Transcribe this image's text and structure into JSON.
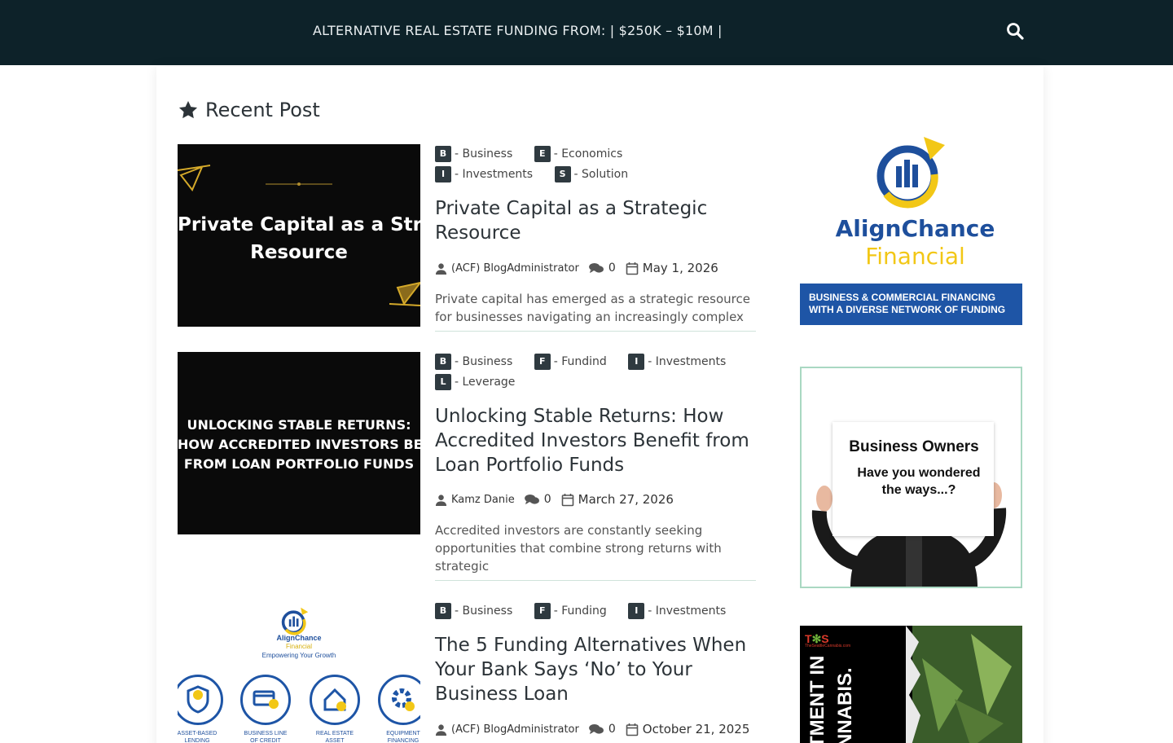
{
  "header": {
    "tagline": "ALTERNATIVE REAL ESTATE FUNDING FROM: | $250K – $10M |",
    "search_icon": "search-icon"
  },
  "section": {
    "title": "Recent Post",
    "icon": "star-icon"
  },
  "posts": [
    {
      "thumb_caption_1": "Private Capital as a Strategic",
      "thumb_caption_2": "Resource",
      "categories": [
        {
          "letter": "B",
          "label": "- Business"
        },
        {
          "letter": "E",
          "label": "- Economics"
        },
        {
          "letter": "I",
          "label": "- Investments"
        },
        {
          "letter": "S",
          "label": "- Solution"
        }
      ],
      "title": "Private Capital as a Strategic Resource",
      "author": "(ACF) BlogAdministrator",
      "comments": "0",
      "date": "May 1, 2026",
      "excerpt": "Private capital has emerged as a strategic resource for businesses navigating an increasingly complex"
    },
    {
      "thumb_caption_1": "UNLOCKING STABLE RETURNS:",
      "thumb_caption_2": "HOW ACCREDITED INVESTORS BENEFIT",
      "thumb_caption_3": "FROM LOAN PORTFOLIO FUNDS",
      "categories": [
        {
          "letter": "B",
          "label": "- Business"
        },
        {
          "letter": "F",
          "label": "- Fundind"
        },
        {
          "letter": "I",
          "label": "- Investments"
        },
        {
          "letter": "L",
          "label": "- Leverage"
        }
      ],
      "title": "Unlocking Stable Returns: How Accredited Investors Benefit from Loan Portfolio Funds",
      "author": "Kamz Danie",
      "comments": "0",
      "date": "March 27, 2026",
      "excerpt": "Accredited investors are constantly seeking opportunities that combine strong returns with strategic"
    },
    {
      "thumb_brand": "AlignChance",
      "thumb_brand_sub": "Financial",
      "thumb_tagline": "Empowering Your Growth",
      "thumb_services": [
        "ASSET-BASED LENDING",
        "BUSINESS LINE OF CREDIT",
        "REAL ESTATE ASSET",
        "EQUIPMENT FINANCING"
      ],
      "categories": [
        {
          "letter": "B",
          "label": "- Business"
        },
        {
          "letter": "F",
          "label": "- Funding"
        },
        {
          "letter": "I",
          "label": "- Investments"
        }
      ],
      "title": "The 5 Funding Alternatives When Your Bank Says ‘No’ to Your Business Loan",
      "author": "(ACF) BlogAdministrator",
      "comments": "0",
      "date": "October 21, 2025"
    }
  ],
  "sidebar": {
    "ad1": {
      "brand_1": "AlignChance",
      "brand_2": "Financial",
      "banner_1": "BUSINESS & COMMERCIAL FINANCING",
      "banner_2": "WITH A DIVERSE NETWORK OF FUNDING"
    },
    "ad2": {
      "heading": "Business Owners",
      "line_1": "Have you wondered",
      "line_2": "the ways...?"
    },
    "ad3": {
      "site": "TheSeattleCannabis.com",
      "big_1": "TMENT IN",
      "big_2": "NNABIS."
    }
  },
  "colors": {
    "header_bg": "#0d2229",
    "badge": "#2f3a40",
    "banner": "#1e55a6",
    "gold": "#f2c716",
    "navy": "#1e4f9c"
  }
}
